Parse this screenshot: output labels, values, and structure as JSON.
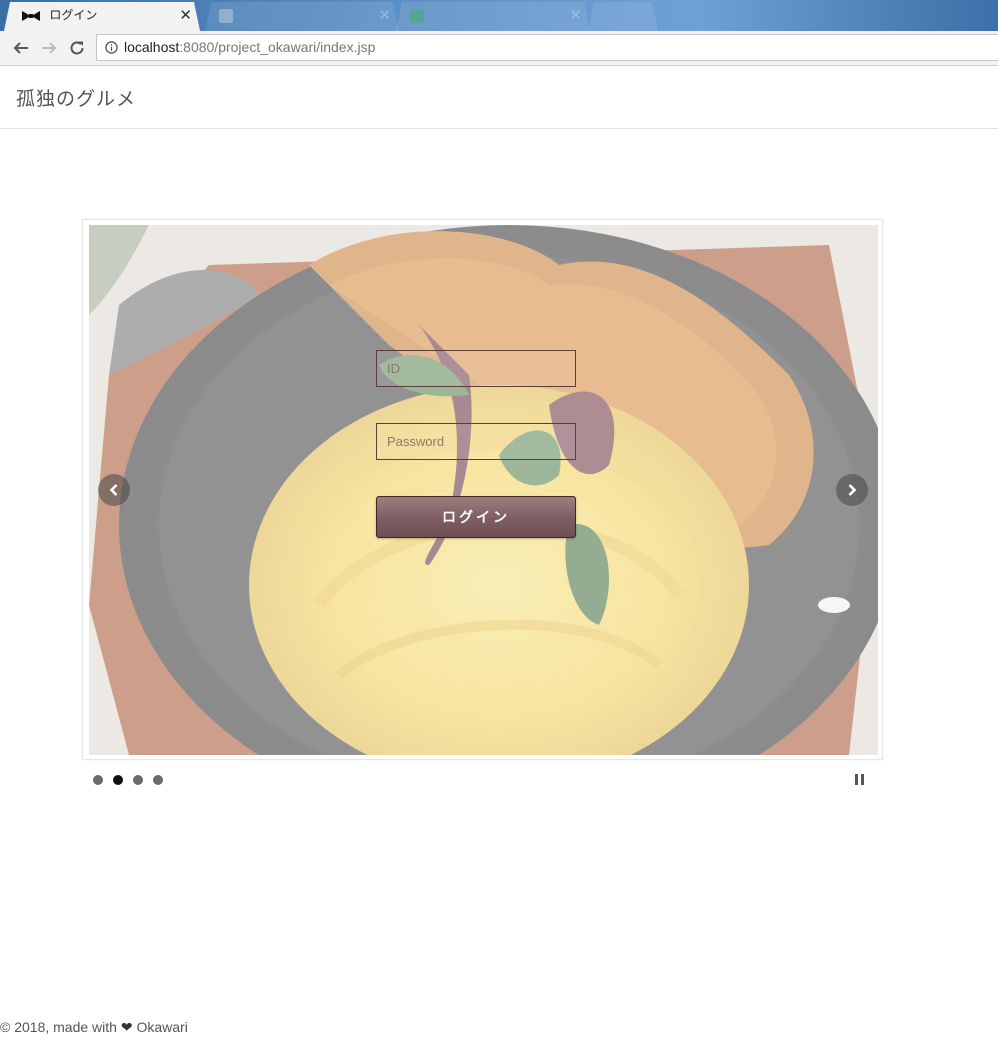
{
  "browser": {
    "active_tab": {
      "title": "ログイン",
      "close": "✕"
    },
    "inactive_tabs": [
      {
        "title": "",
        "close": "✕"
      },
      {
        "title": "",
        "close": "✕"
      },
      {
        "title": ""
      }
    ],
    "address": {
      "host": "localhost",
      "path": ":8080/project_okawari/index.jsp"
    }
  },
  "site": {
    "brand": "孤独のグルメ"
  },
  "login": {
    "id_placeholder": "ID",
    "password_placeholder": "Password",
    "submit_label": "ログイン"
  },
  "carousel": {
    "slide_count": 4,
    "active_index": 1,
    "prev_icon": "chevron-left-icon",
    "next_icon": "chevron-right-icon",
    "pause_icon": "pause-icon"
  },
  "footer": {
    "prefix": "© 2018, made with",
    "heart": "❤",
    "suffix": "Okawari"
  }
}
